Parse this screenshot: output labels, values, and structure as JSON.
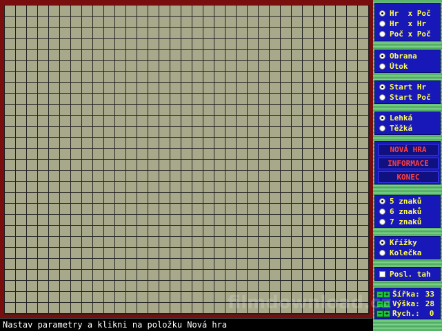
{
  "mode_group": [
    {
      "label": "Hr  x Poč",
      "selected": true
    },
    {
      "label": "Hr  x Hr",
      "selected": false
    },
    {
      "label": "Poč x Poč",
      "selected": false
    }
  ],
  "strategy_group": [
    {
      "label": "Obrana",
      "selected": true
    },
    {
      "label": "Útok",
      "selected": false
    }
  ],
  "start_group": [
    {
      "label": "Start Hr",
      "selected": true
    },
    {
      "label": "Start Poč",
      "selected": false
    }
  ],
  "difficulty_group": [
    {
      "label": "Lehká",
      "selected": true
    },
    {
      "label": "Těžká",
      "selected": false
    }
  ],
  "buttons": {
    "new_game": "NOVÁ HRA",
    "info": "INFORMACE",
    "quit": "KONEC"
  },
  "win_length_group": [
    {
      "label": "5 znaků",
      "selected": true
    },
    {
      "label": "6 znaků",
      "selected": false
    },
    {
      "label": "7 znaků",
      "selected": false
    }
  ],
  "symbol_group": [
    {
      "label": "Křížky",
      "selected": true
    },
    {
      "label": "Kolečka",
      "selected": false
    }
  ],
  "last_move": {
    "label": "Posl. tah",
    "checked": false
  },
  "dimensions": {
    "width_label": "Šířka:",
    "width_value": "33",
    "height_label": "Výška:",
    "height_value": "28",
    "speed_label": "Rych.:",
    "speed_value": "0"
  },
  "status": "Nastav parametry a klikni na položku Nová hra",
  "watermark": "filmdownload.cz",
  "colors": {
    "board_border": "#7a0e0e",
    "board_cell": "#a8a88a",
    "grid_line": "#1f1f1f",
    "panel_bg": "#1818b8",
    "label_text": "#ffff50",
    "button_text": "#ff4040",
    "sidebar_bg": "#6cc07a"
  }
}
